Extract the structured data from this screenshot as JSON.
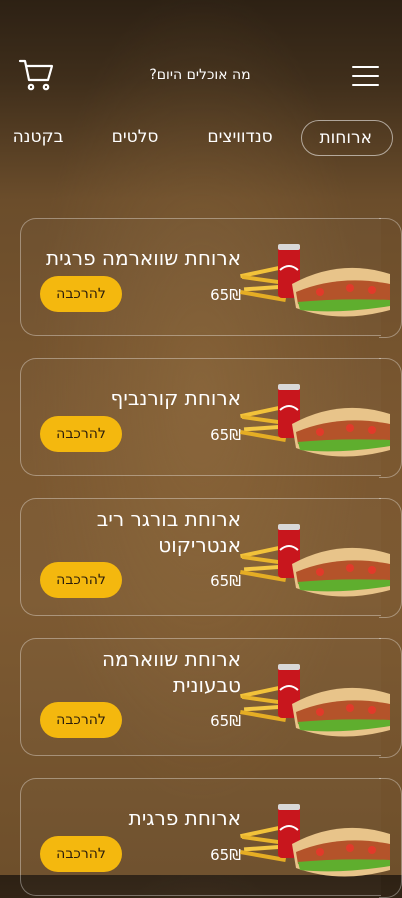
{
  "header": {
    "title": "מה אוכלים היום?",
    "menu_icon": "hamburger-menu-icon",
    "cart_icon": "shopping-cart-icon"
  },
  "tabs": [
    {
      "label": "ארוחות",
      "active": true
    },
    {
      "label": "סנדוויצים",
      "active": false
    },
    {
      "label": "סלטים",
      "active": false
    },
    {
      "label": "בקטנה",
      "active": false
    }
  ],
  "colors": {
    "accent": "#f4b80e",
    "background": "#7a5730",
    "text": "#ffffff"
  },
  "items": [
    {
      "title": "ארוחת שווארמה פרגית",
      "price": "65₪",
      "button": "להרכבה"
    },
    {
      "title": "ארוחת קורנביף",
      "price": "65₪",
      "button": "להרכבה"
    },
    {
      "title": "ארוחת בורגר ריב אנטריקוט",
      "price": "65₪",
      "button": "להרכבה"
    },
    {
      "title": "ארוחת שווארמה טבעונית",
      "price": "65₪",
      "button": "להרכבה"
    },
    {
      "title": "ארוחת פרגית",
      "price": "65₪",
      "button": "להרכבה"
    }
  ]
}
